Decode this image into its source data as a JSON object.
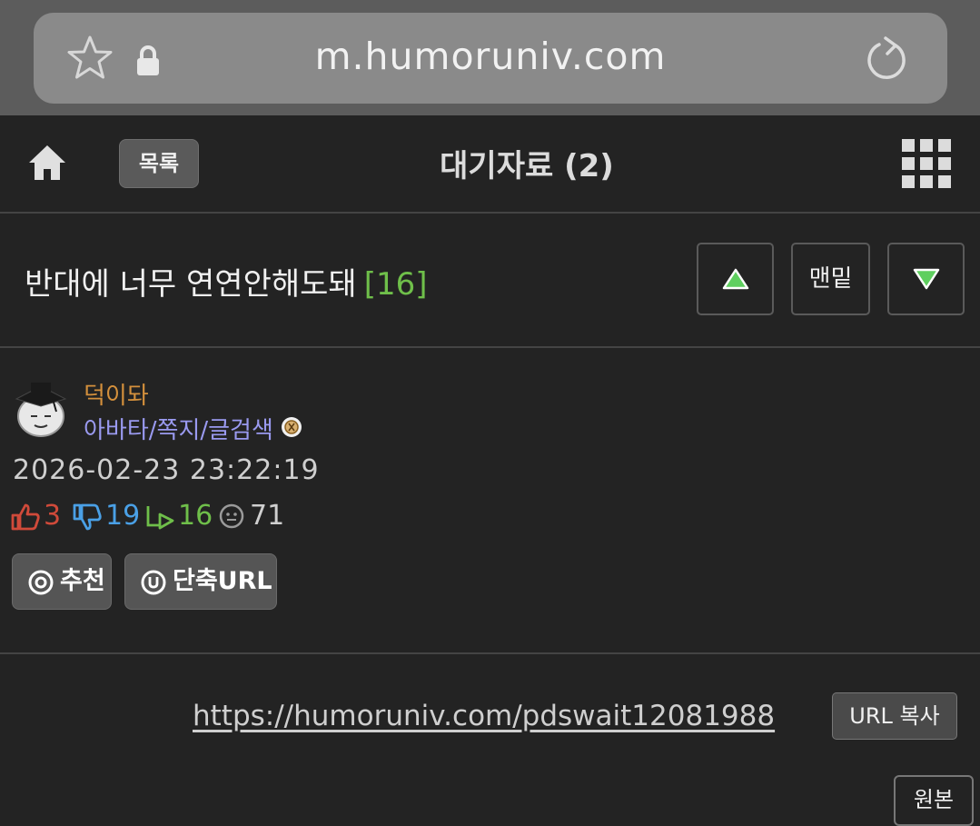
{
  "browser": {
    "url": "m.humoruniv.com"
  },
  "navbar": {
    "list_label": "목록",
    "title": "대기자료 (2)"
  },
  "post": {
    "title": "반대에 너무 연연안해도돼",
    "comment_count": "[16]",
    "bottom_label": "맨밑"
  },
  "author": {
    "name": "덕이돠",
    "links": "아바타/쪽지/글검색",
    "date": "2026-02-23 23:22:19"
  },
  "stats": {
    "likes": "3",
    "dislikes": "19",
    "comments": "16",
    "views": "71"
  },
  "actions": {
    "recommend_label": "추천",
    "short_url_label": "단축URL"
  },
  "share": {
    "short_url": "https://humoruniv.com/pdswait12081988",
    "copy_label": "URL 복사",
    "original_label": "원본"
  },
  "colors": {
    "likes": "#d04a3a",
    "dislikes": "#4aa0e6",
    "comments": "#6fbf4a",
    "author_name": "#d4903c",
    "author_links": "#9a9af0"
  }
}
